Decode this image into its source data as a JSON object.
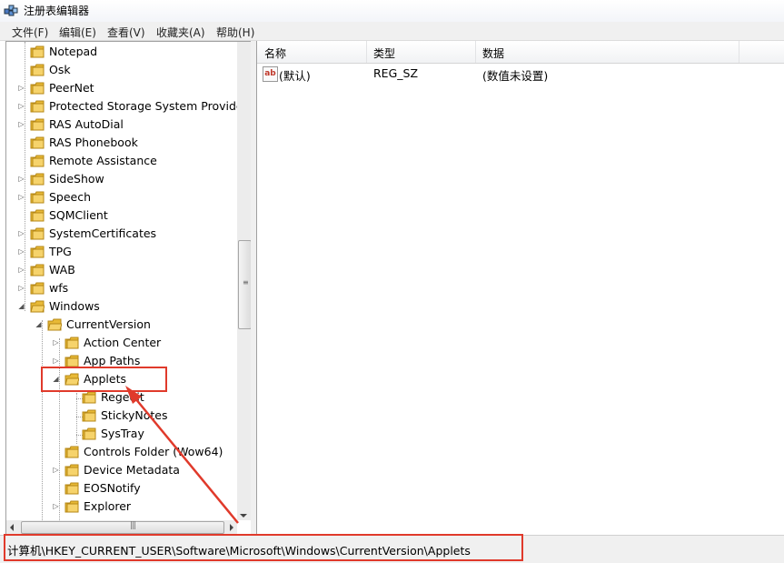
{
  "window": {
    "title": "注册表编辑器",
    "icon": "registry-editor-icon"
  },
  "menu": [
    "文件(F)",
    "编辑(E)",
    "查看(V)",
    "收藏夹(A)",
    "帮助(H)"
  ],
  "tree": [
    {
      "label": "Notepad",
      "expander": "none"
    },
    {
      "label": "Osk",
      "expander": "none"
    },
    {
      "label": "PeerNet",
      "expander": "collapsed"
    },
    {
      "label": "Protected Storage System Provider",
      "expander": "collapsed"
    },
    {
      "label": "RAS AutoDial",
      "expander": "collapsed"
    },
    {
      "label": "RAS Phonebook",
      "expander": "none"
    },
    {
      "label": "Remote Assistance",
      "expander": "none"
    },
    {
      "label": "SideShow",
      "expander": "collapsed"
    },
    {
      "label": "Speech",
      "expander": "collapsed"
    },
    {
      "label": "SQMClient",
      "expander": "none"
    },
    {
      "label": "SystemCertificates",
      "expander": "collapsed"
    },
    {
      "label": "TPG",
      "expander": "collapsed"
    },
    {
      "label": "WAB",
      "expander": "collapsed"
    },
    {
      "label": "wfs",
      "expander": "collapsed"
    },
    {
      "label": "Windows",
      "expander": "expanded"
    },
    {
      "label": "CurrentVersion",
      "expander": "expanded"
    },
    {
      "label": "Action Center",
      "expander": "collapsed"
    },
    {
      "label": "App Paths",
      "expander": "collapsed"
    },
    {
      "label": "Applets",
      "expander": "expanded"
    },
    {
      "label": "Regedit",
      "expander": "none"
    },
    {
      "label": "StickyNotes",
      "expander": "none"
    },
    {
      "label": "SysTray",
      "expander": "none"
    },
    {
      "label": "Controls Folder (Wow64)",
      "expander": "none"
    },
    {
      "label": "Device Metadata",
      "expander": "collapsed"
    },
    {
      "label": "EOSNotify",
      "expander": "none"
    },
    {
      "label": "Explorer",
      "expander": "collapsed"
    }
  ],
  "list": {
    "columns": [
      "名称",
      "类型",
      "数据"
    ],
    "rows": [
      {
        "name": "(默认)",
        "type": "REG_SZ",
        "data": "(数值未设置)",
        "icon": "string-value-icon"
      }
    ]
  },
  "status": {
    "path": "计算机\\HKEY_CURRENT_USER\\Software\\Microsoft\\Windows\\CurrentVersion\\Applets"
  },
  "colors": {
    "annotation": "#e03a2b",
    "folder": "#e8b936"
  }
}
